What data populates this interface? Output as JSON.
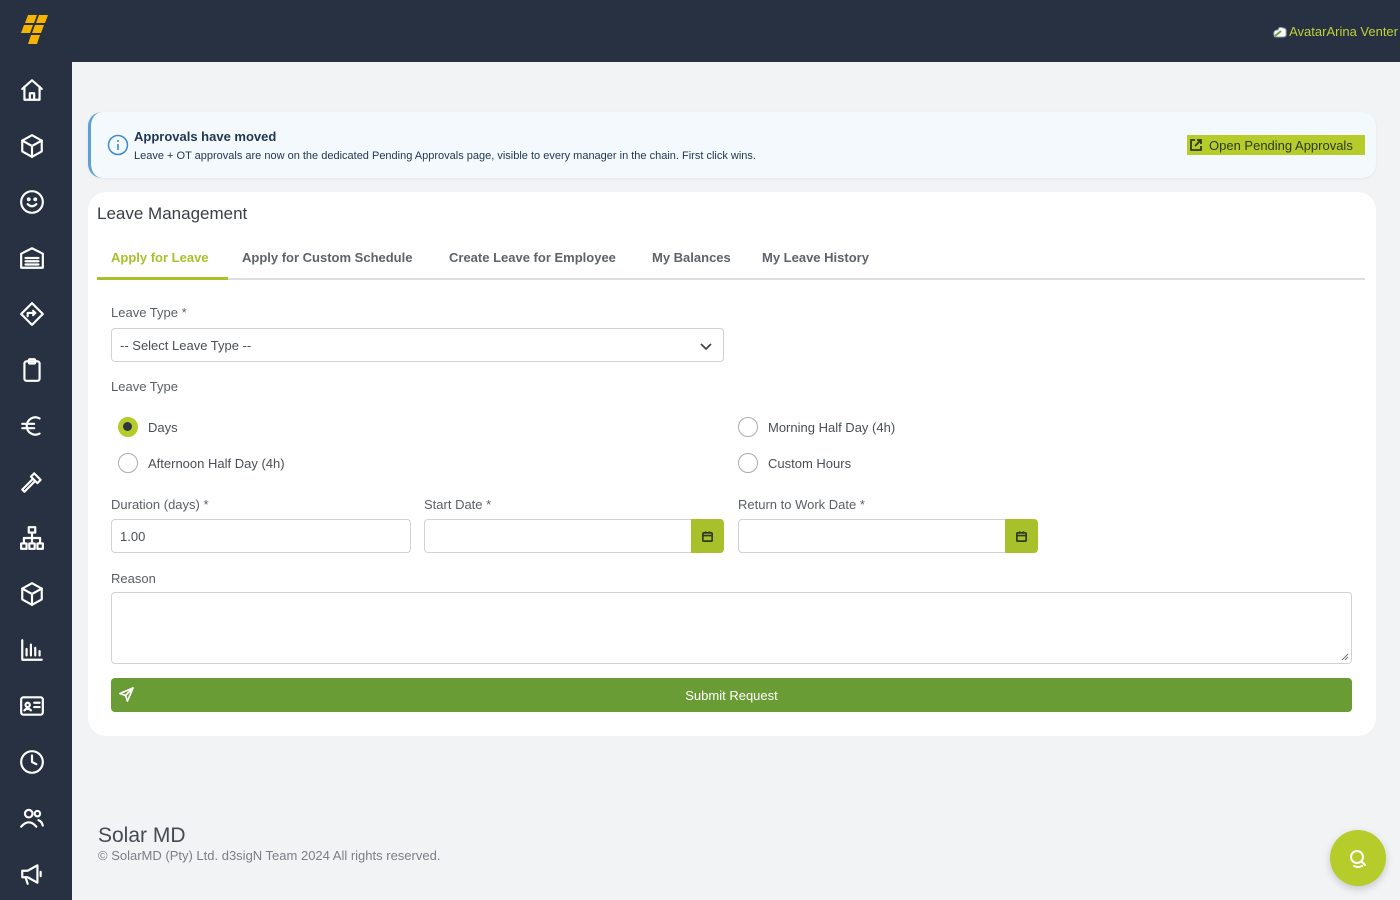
{
  "header": {
    "user_name": "AvatarArina Venter",
    "avatar_alt": "Avatar"
  },
  "sidebar": {
    "items": [
      {
        "icon": "home-icon"
      },
      {
        "icon": "box-icon"
      },
      {
        "icon": "smiley-icon"
      },
      {
        "icon": "warehouse-icon"
      },
      {
        "icon": "directions-icon"
      },
      {
        "icon": "clipboard-icon"
      },
      {
        "icon": "euro-icon"
      },
      {
        "icon": "hammer-icon"
      },
      {
        "icon": "org-chart-icon"
      },
      {
        "icon": "package-icon"
      },
      {
        "icon": "bar-chart-icon"
      },
      {
        "icon": "id-card-icon"
      },
      {
        "icon": "clock-icon"
      },
      {
        "icon": "users-icon"
      },
      {
        "icon": "megaphone-icon"
      }
    ]
  },
  "banner": {
    "title": "Approvals have moved",
    "text": "Leave + OT approvals are now on the dedicated Pending Approvals page, visible to every manager in the chain. First click wins.",
    "button_label": "Open Pending Approvals"
  },
  "card": {
    "title": "Leave Management",
    "tabs": [
      {
        "label": "Apply for Leave",
        "active": true
      },
      {
        "label": "Apply for Custom Schedule",
        "active": false
      },
      {
        "label": "Create Leave for Employee",
        "active": false
      },
      {
        "label": "My Balances",
        "active": false
      },
      {
        "label": "My Leave History",
        "active": false
      }
    ]
  },
  "form": {
    "leave_type_label": "Leave Type *",
    "leave_type_value": "-- Select Leave Type --",
    "leave_kind_label": "Leave Type",
    "radios": [
      {
        "label": "Days",
        "checked": true
      },
      {
        "label": "Morning Half Day (4h)",
        "checked": false
      },
      {
        "label": "Afternoon Half Day (4h)",
        "checked": false
      },
      {
        "label": "Custom Hours",
        "checked": false
      }
    ],
    "duration_label": "Duration (days) *",
    "duration_value": "1.00",
    "start_date_label": "Start Date *",
    "start_date_value": "",
    "return_date_label": "Return to Work Date *",
    "return_date_value": "",
    "reason_label": "Reason",
    "reason_value": "",
    "submit_label": "Submit Request"
  },
  "footer": {
    "title": "Solar MD",
    "copyright": "© SolarMD (Pty) Ltd. d3sigN Team 2024 All rights reserved."
  },
  "colors": {
    "topbar": "#283141",
    "accent": "#a8c12a",
    "submit": "#6a9c35",
    "banner_border": "#5ba0d6"
  }
}
